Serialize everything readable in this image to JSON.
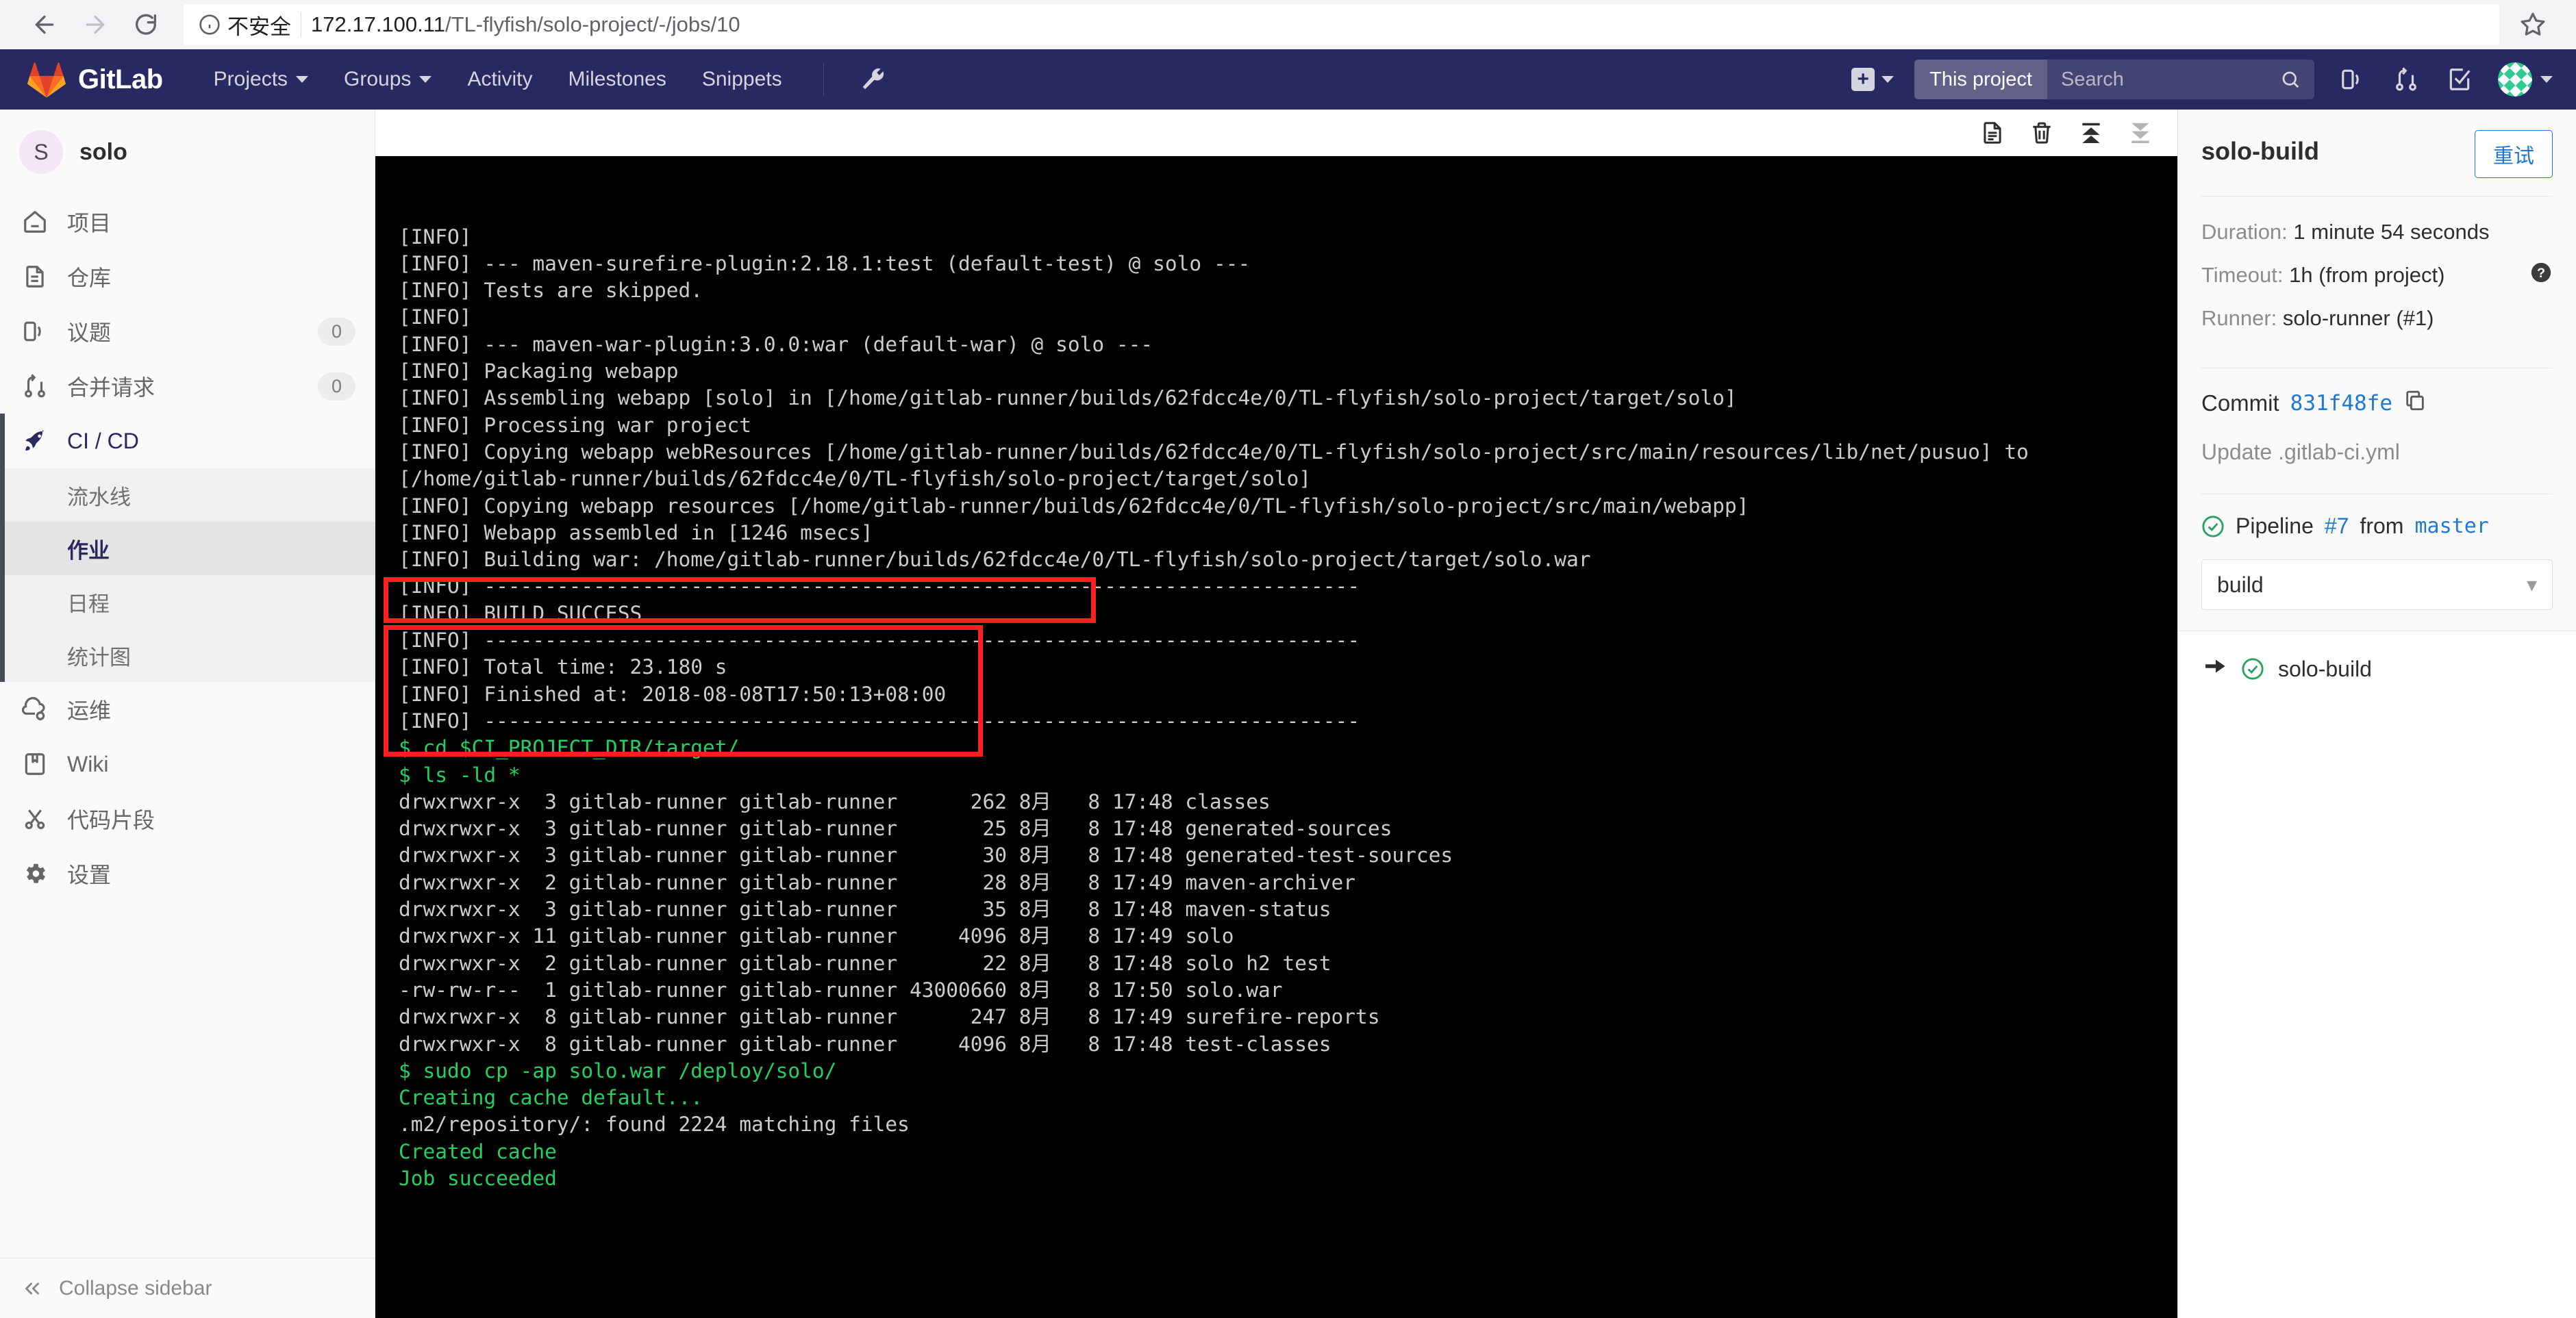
{
  "browser": {
    "back_icon": "back-arrow-icon",
    "forward_icon": "forward-arrow-icon",
    "reload_icon": "reload-icon",
    "insecure_label": "不安全",
    "url_host": "172.17.100.11",
    "url_path": "/TL-flyfish/solo-project/-/jobs/10",
    "star_icon": "star-icon"
  },
  "navbar": {
    "brand": "GitLab",
    "links": [
      {
        "label": "Projects",
        "has_caret": true
      },
      {
        "label": "Groups",
        "has_caret": true
      },
      {
        "label": "Activity",
        "has_caret": false
      },
      {
        "label": "Milestones",
        "has_caret": false
      },
      {
        "label": "Snippets",
        "has_caret": false
      }
    ],
    "admin_icon": "wrench-icon",
    "plus_label": "+",
    "search_scope": "This project",
    "search_placeholder": "Search",
    "icons": [
      "issues-icon",
      "merge-requests-icon",
      "todos-icon"
    ],
    "avatar_icon": "user-avatar"
  },
  "sidebar": {
    "project_initial": "S",
    "project_name": "solo",
    "items": [
      {
        "label": "项目",
        "icon": "home-icon",
        "badge": ""
      },
      {
        "label": "仓库",
        "icon": "document-icon",
        "badge": ""
      },
      {
        "label": "议题",
        "icon": "issues-icon",
        "badge": "0"
      },
      {
        "label": "合并请求",
        "icon": "merge-request-icon",
        "badge": "0"
      },
      {
        "label": "CI / CD",
        "icon": "rocket-icon",
        "badge": ""
      }
    ],
    "cicd_subitems": [
      {
        "label": "流水线",
        "active": false
      },
      {
        "label": "作业",
        "active": true
      },
      {
        "label": "日程",
        "active": false
      },
      {
        "label": "统计图",
        "active": false
      }
    ],
    "lower_items": [
      {
        "label": "运维",
        "icon": "cloud-gear-icon"
      },
      {
        "label": "Wiki",
        "icon": "book-icon"
      },
      {
        "label": "代码片段",
        "icon": "snippet-icon"
      },
      {
        "label": "设置",
        "icon": "gear-icon"
      }
    ],
    "collapse_label": "Collapse sidebar"
  },
  "log_toolbar": {
    "raw_icon": "raw-log-icon",
    "erase_icon": "trash-icon",
    "scroll_top_icon": "scroll-to-top-icon",
    "scroll_bottom_icon": "scroll-to-bottom-icon"
  },
  "terminal": {
    "lines": [
      {
        "text": "[INFO]",
        "color": "white"
      },
      {
        "text": "[INFO] --- maven-surefire-plugin:2.18.1:test (default-test) @ solo ---",
        "color": "white"
      },
      {
        "text": "[INFO] Tests are skipped.",
        "color": "white"
      },
      {
        "text": "[INFO]",
        "color": "white"
      },
      {
        "text": "[INFO] --- maven-war-plugin:3.0.0:war (default-war) @ solo ---",
        "color": "white"
      },
      {
        "text": "[INFO] Packaging webapp",
        "color": "white"
      },
      {
        "text": "[INFO] Assembling webapp [solo] in [/home/gitlab-runner/builds/62fdcc4e/0/TL-flyfish/solo-project/target/solo]",
        "color": "white"
      },
      {
        "text": "[INFO] Processing war project",
        "color": "white"
      },
      {
        "text": "[INFO] Copying webapp webResources [/home/gitlab-runner/builds/62fdcc4e/0/TL-flyfish/solo-project/src/main/resources/lib/net/pusuo] to",
        "color": "white"
      },
      {
        "text": "[/home/gitlab-runner/builds/62fdcc4e/0/TL-flyfish/solo-project/target/solo]",
        "color": "white"
      },
      {
        "text": "[INFO] Copying webapp resources [/home/gitlab-runner/builds/62fdcc4e/0/TL-flyfish/solo-project/src/main/webapp]",
        "color": "white"
      },
      {
        "text": "[INFO] Webapp assembled in [1246 msecs]",
        "color": "white"
      },
      {
        "text": "[INFO] Building war: /home/gitlab-runner/builds/62fdcc4e/0/TL-flyfish/solo-project/target/solo.war",
        "color": "white"
      },
      {
        "text": "[INFO] ------------------------------------------------------------------------",
        "color": "white"
      },
      {
        "text": "[INFO] BUILD SUCCESS",
        "color": "white"
      },
      {
        "text": "[INFO] ------------------------------------------------------------------------",
        "color": "white"
      },
      {
        "text": "[INFO] Total time: 23.180 s",
        "color": "white"
      },
      {
        "text": "[INFO] Finished at: 2018-08-08T17:50:13+08:00",
        "color": "white"
      },
      {
        "text": "[INFO] ------------------------------------------------------------------------",
        "color": "white"
      },
      {
        "text": "$ cd $CI_PROJECT_DIR/target/",
        "color": "green"
      },
      {
        "text": "$ ls -ld *",
        "color": "green"
      },
      {
        "text": "drwxrwxr-x  3 gitlab-runner gitlab-runner      262 8月   8 17:48 classes",
        "color": "white"
      },
      {
        "text": "drwxrwxr-x  3 gitlab-runner gitlab-runner       25 8月   8 17:48 generated-sources",
        "color": "white"
      },
      {
        "text": "drwxrwxr-x  3 gitlab-runner gitlab-runner       30 8月   8 17:48 generated-test-sources",
        "color": "white"
      },
      {
        "text": "drwxrwxr-x  2 gitlab-runner gitlab-runner       28 8月   8 17:49 maven-archiver",
        "color": "white"
      },
      {
        "text": "drwxrwxr-x  3 gitlab-runner gitlab-runner       35 8月   8 17:48 maven-status",
        "color": "white"
      },
      {
        "text": "drwxrwxr-x 11 gitlab-runner gitlab-runner     4096 8月   8 17:49 solo",
        "color": "white"
      },
      {
        "text": "drwxrwxr-x  2 gitlab-runner gitlab-runner       22 8月   8 17:48 solo h2 test",
        "color": "white"
      },
      {
        "text": "-rw-rw-r--  1 gitlab-runner gitlab-runner 43000660 8月   8 17:50 solo.war",
        "color": "white"
      },
      {
        "text": "drwxrwxr-x  8 gitlab-runner gitlab-runner      247 8月   8 17:49 surefire-reports",
        "color": "white"
      },
      {
        "text": "drwxrwxr-x  8 gitlab-runner gitlab-runner     4096 8月   8 17:48 test-classes",
        "color": "white"
      },
      {
        "text": "$ sudo cp -ap solo.war /deploy/solo/",
        "color": "green"
      },
      {
        "text": "Creating cache default...",
        "color": "green"
      },
      {
        "text": ".m2/repository/: found 2224 matching files",
        "color": "white"
      },
      {
        "text": "Created cache",
        "color": "green"
      },
      {
        "text": "Job succeeded",
        "color": "green"
      }
    ],
    "annotation_color": "#ff1f1f"
  },
  "right_panel": {
    "job_title": "solo-build",
    "retry_label": "重试",
    "duration_label": "Duration:",
    "duration_value": "1 minute 54 seconds",
    "timeout_label": "Timeout:",
    "timeout_value": "1h (from project)",
    "runner_label": "Runner:",
    "runner_value": "solo-runner (#1)",
    "commit_label": "Commit",
    "commit_sha": "831f48fe",
    "commit_message": "Update .gitlab-ci.yml",
    "pipeline_prefix": "Pipeline",
    "pipeline_number": "#7",
    "pipeline_from": "from",
    "pipeline_branch": "master",
    "stage_selected": "build",
    "jobs": [
      {
        "name": "solo-build",
        "status": "success"
      }
    ]
  }
}
